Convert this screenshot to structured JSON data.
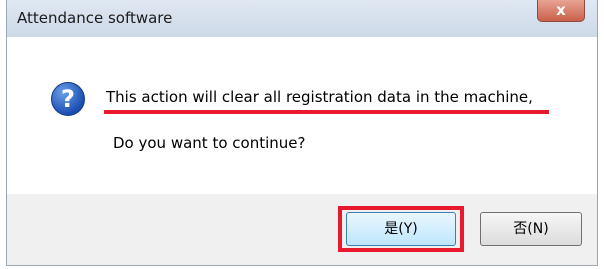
{
  "window": {
    "title": "Attendance software",
    "close_symbol": "x"
  },
  "dialog": {
    "icon": "question-icon",
    "icon_glyph": "?",
    "message": "This action will clear all registration data in the machine,",
    "question": "Do you want to continue?"
  },
  "buttons": {
    "yes_label": "是(Y)",
    "no_label": "否(N)"
  },
  "annotations": {
    "highlight_color": "#e8192c"
  }
}
